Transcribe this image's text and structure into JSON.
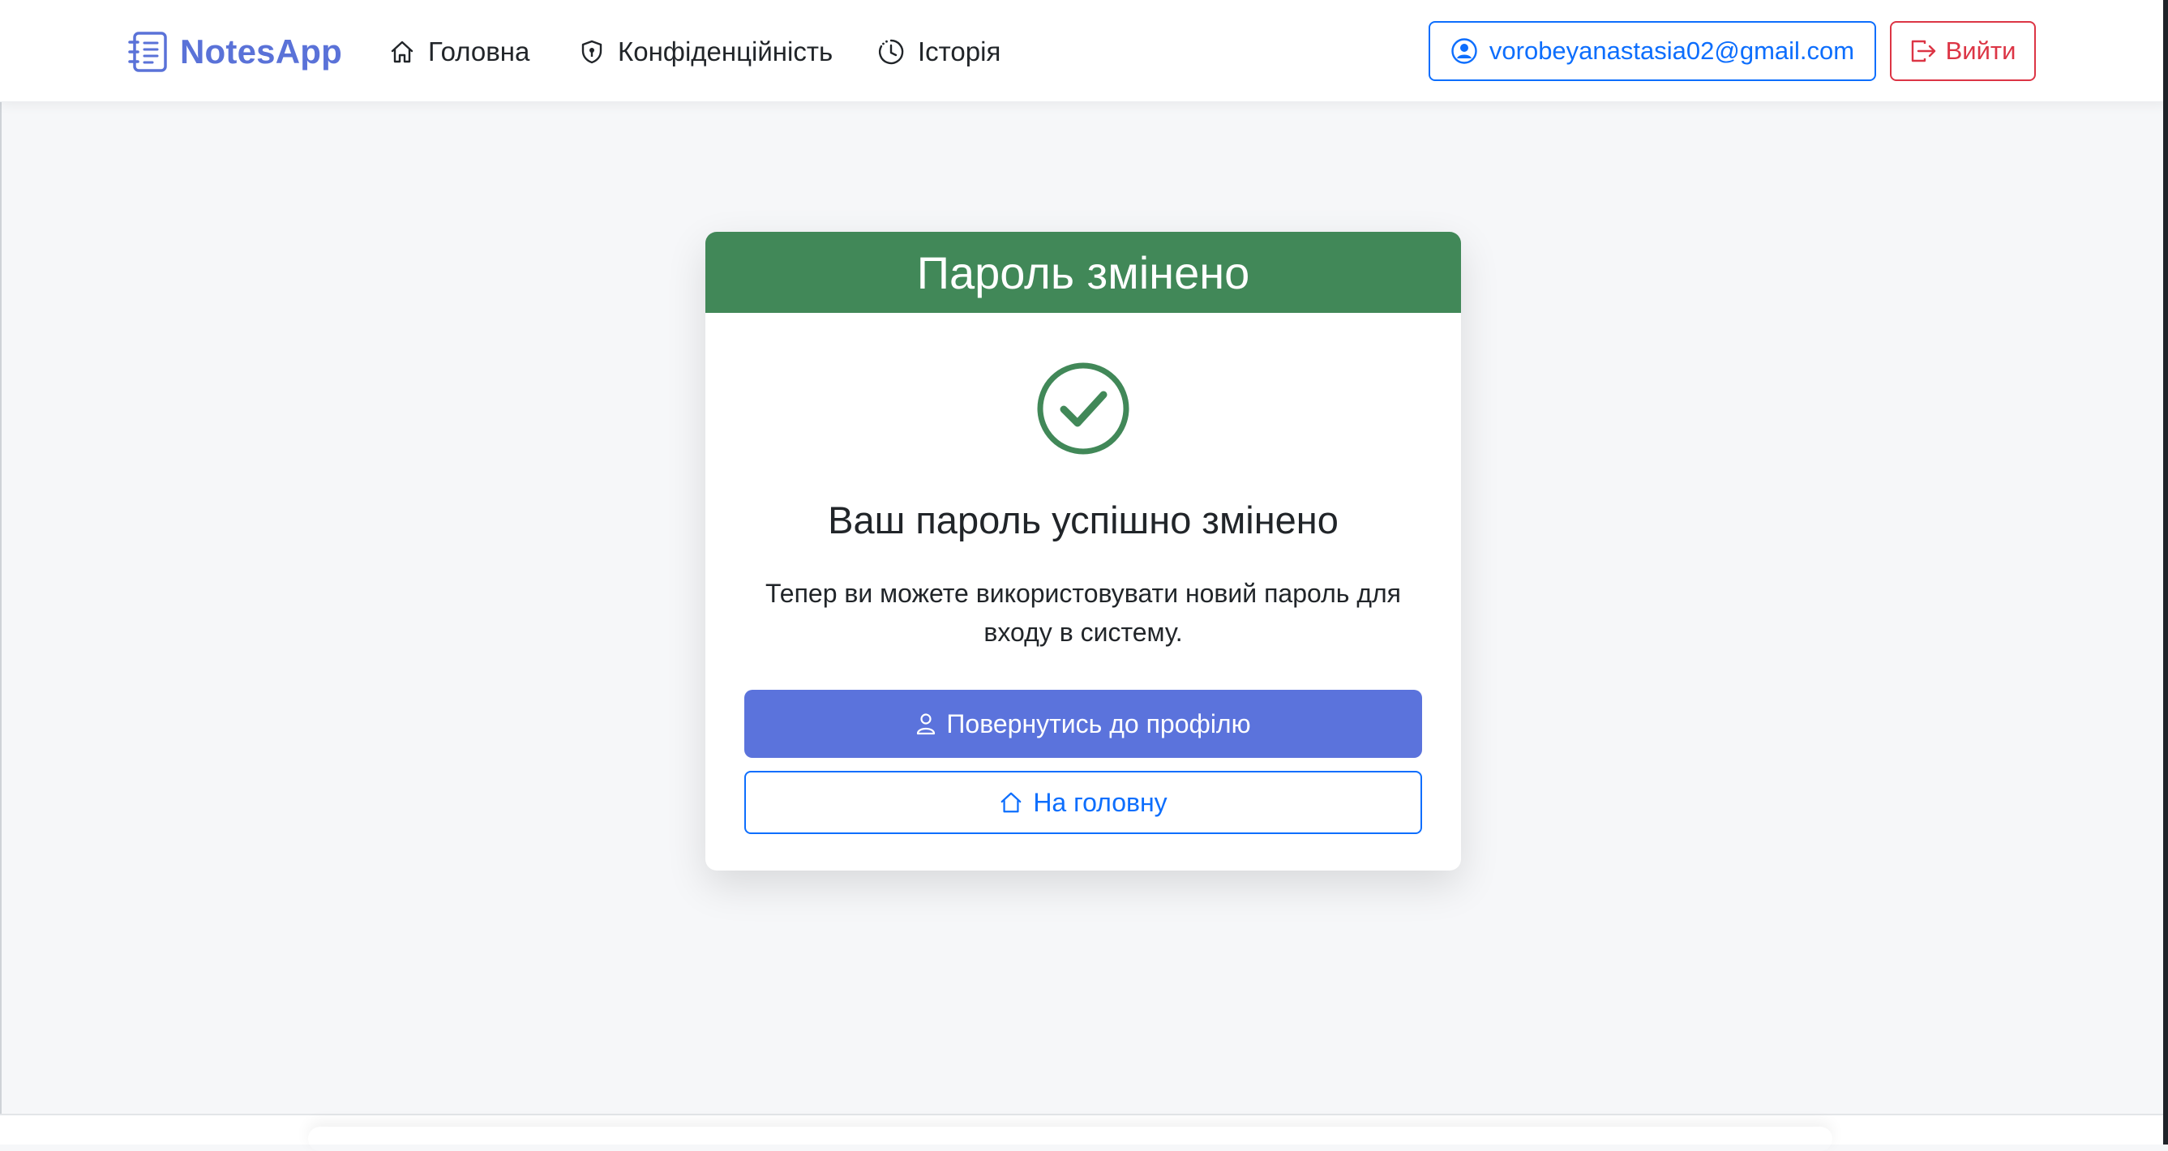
{
  "navbar": {
    "brand": "NotesApp",
    "links": [
      {
        "label": "Головна",
        "icon": "home-icon"
      },
      {
        "label": "Конфіденційність",
        "icon": "shield-icon"
      },
      {
        "label": "Історія",
        "icon": "clock-history-icon"
      }
    ],
    "user_email": "vorobeyanastasia02@gmail.com",
    "logout_label": "Вийти"
  },
  "card": {
    "header": "Пароль змінено",
    "title": "Ваш пароль успішно змінено",
    "text": "Тепер ви можете використовувати новий пароль для входу в систему.",
    "primary_button": "Повернутись до профілю",
    "secondary_button": "На головну"
  },
  "colors": {
    "brand": "#5a72d8",
    "success": "#418858",
    "primary": "#5b73dc",
    "link_blue": "#0d6efd",
    "danger": "#dc3545",
    "background": "#f6f7f9"
  }
}
